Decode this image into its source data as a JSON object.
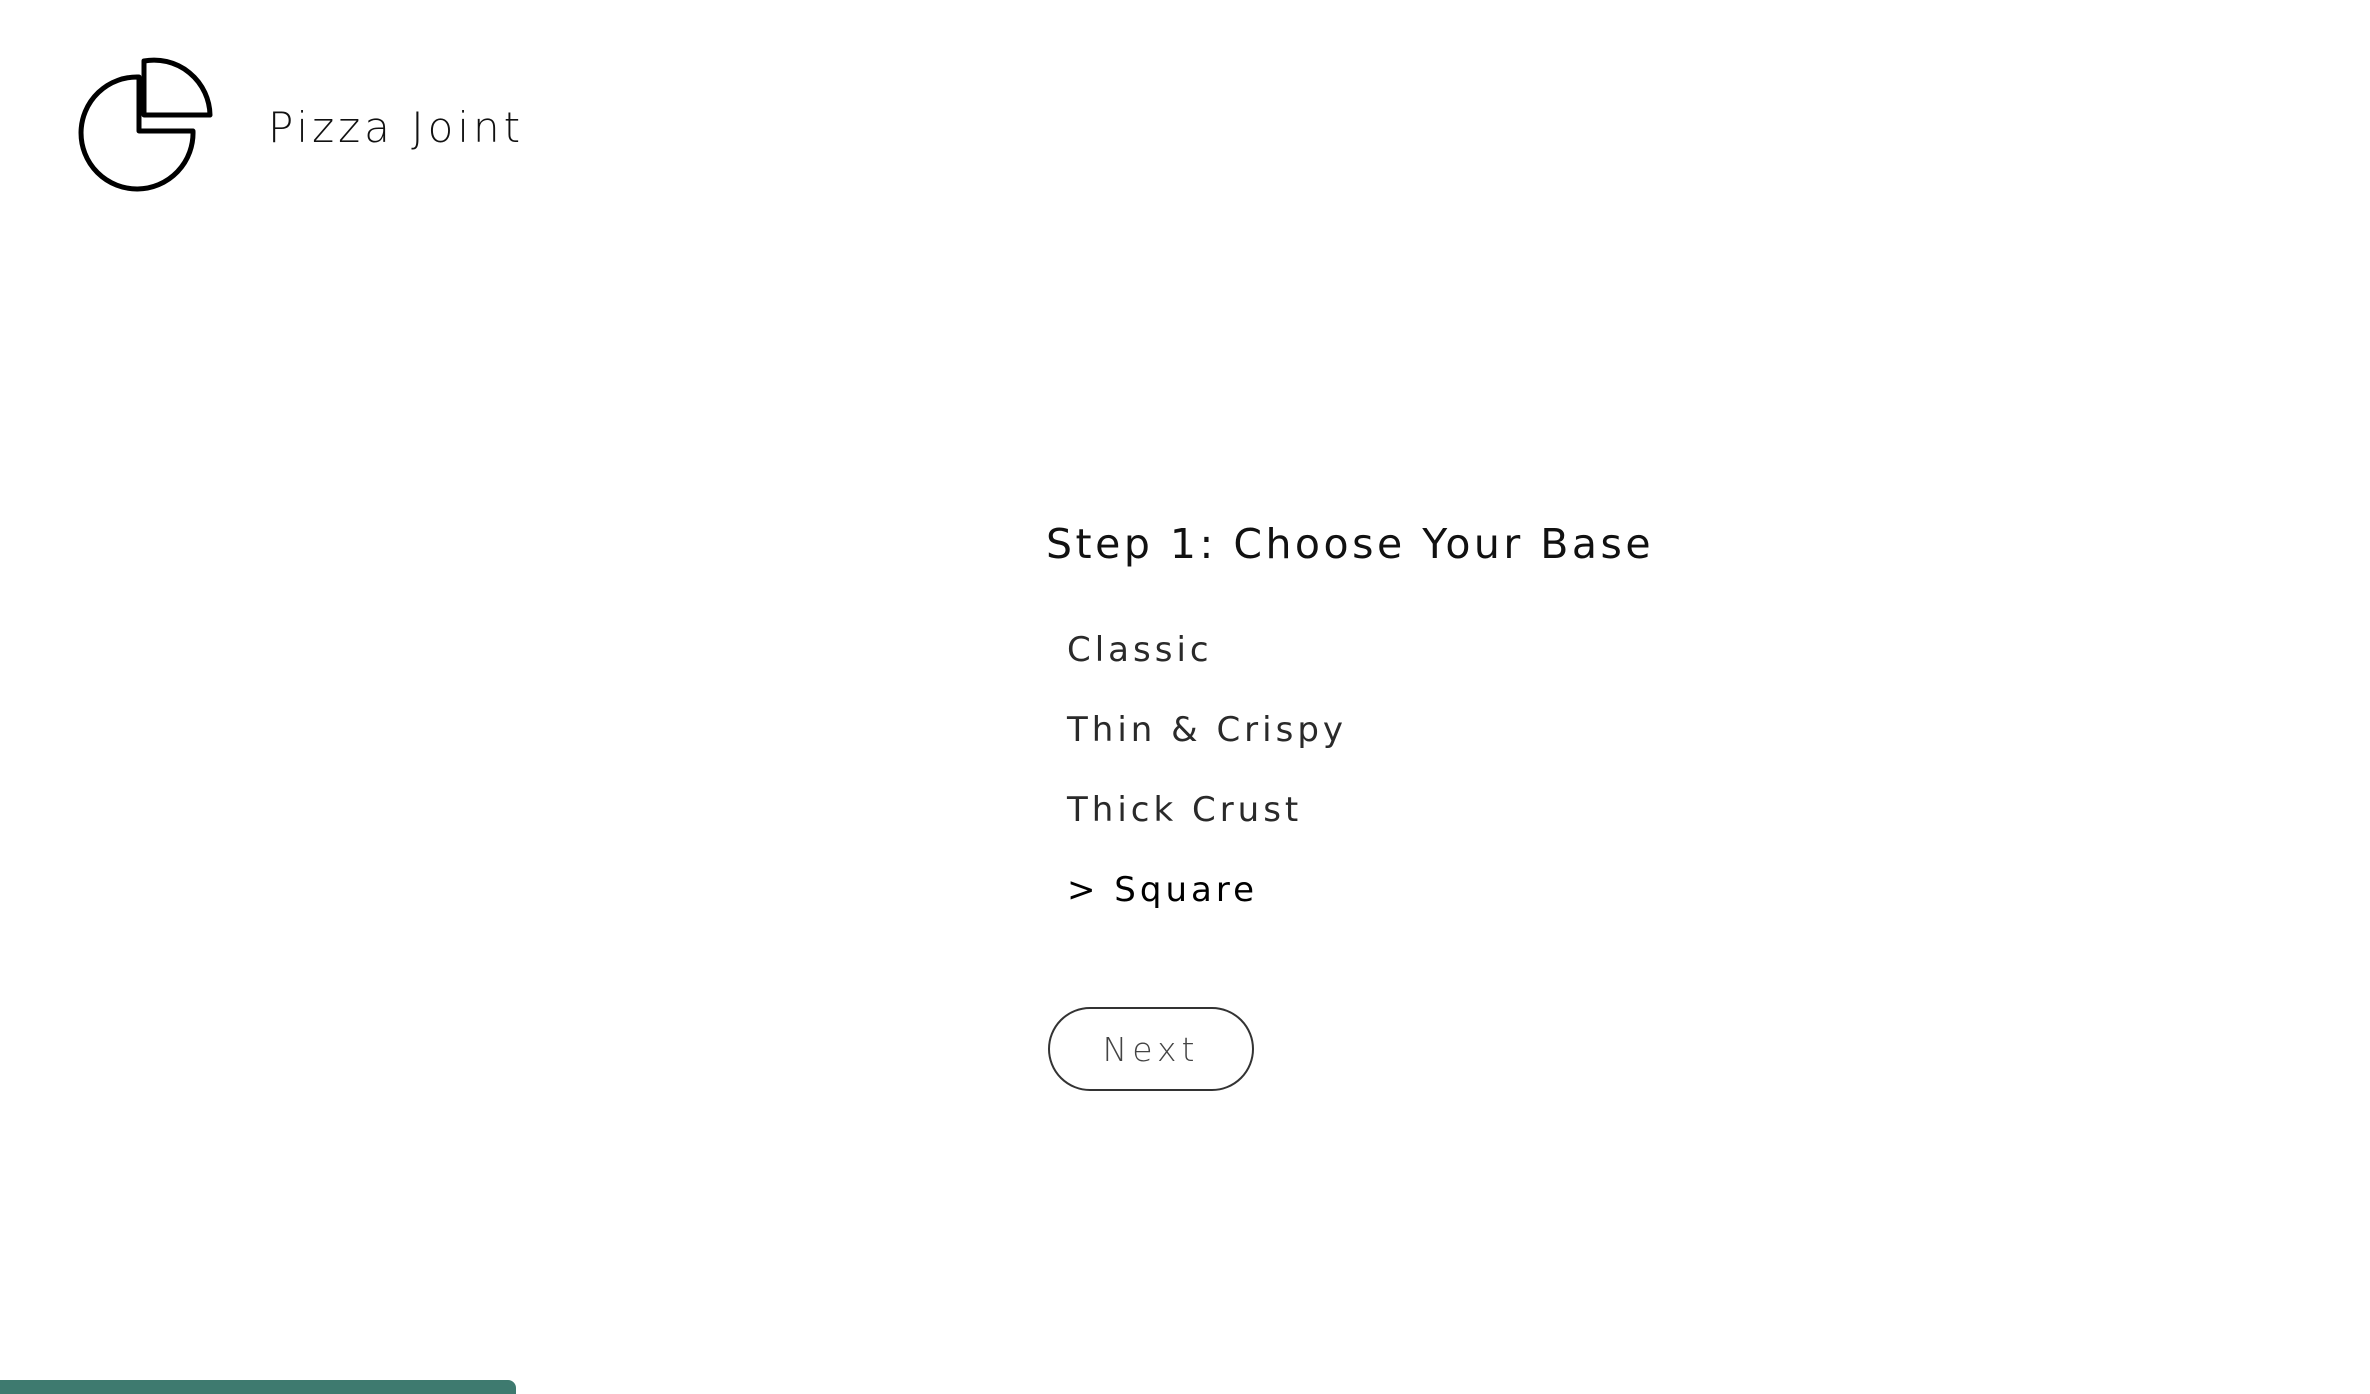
{
  "header": {
    "brand_name": "Pizza Joint",
    "logo_icon": "pie-chart-icon"
  },
  "step": {
    "title": "Step 1: Choose Your Base",
    "options": [
      {
        "label": "Classic"
      },
      {
        "label": "Thin & Crispy"
      },
      {
        "label": "Thick Crust"
      },
      {
        "label": "> Square",
        "selected": true
      }
    ],
    "next_label": "Next"
  },
  "colors": {
    "text": "#111111",
    "button_border": "#333333",
    "status_bar": "#3e7a6f"
  }
}
